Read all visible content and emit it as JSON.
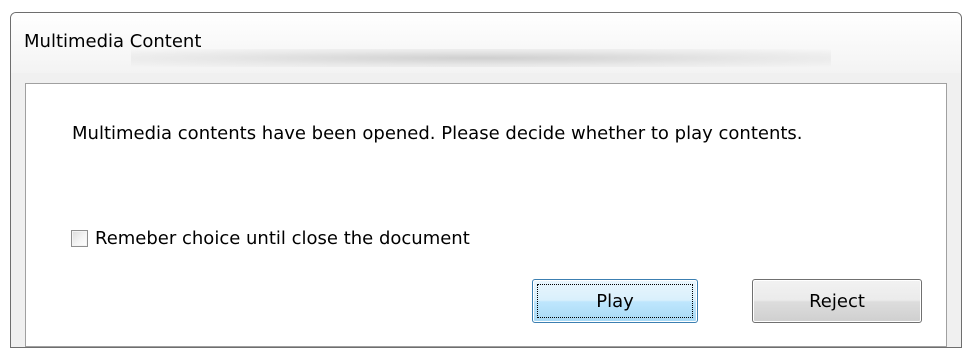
{
  "window": {
    "title": "Multimedia Content"
  },
  "message": {
    "text": "Multimedia contents have been opened.  Please decide whether to play contents."
  },
  "remember_checkbox": {
    "label": "Remeber choice until close the document",
    "checked": false
  },
  "buttons": {
    "play_label": "Play",
    "reject_label": "Reject"
  },
  "colors": {
    "primary_button_border": "#3c7fb1",
    "primary_button_fill": "#d9f0fc"
  }
}
